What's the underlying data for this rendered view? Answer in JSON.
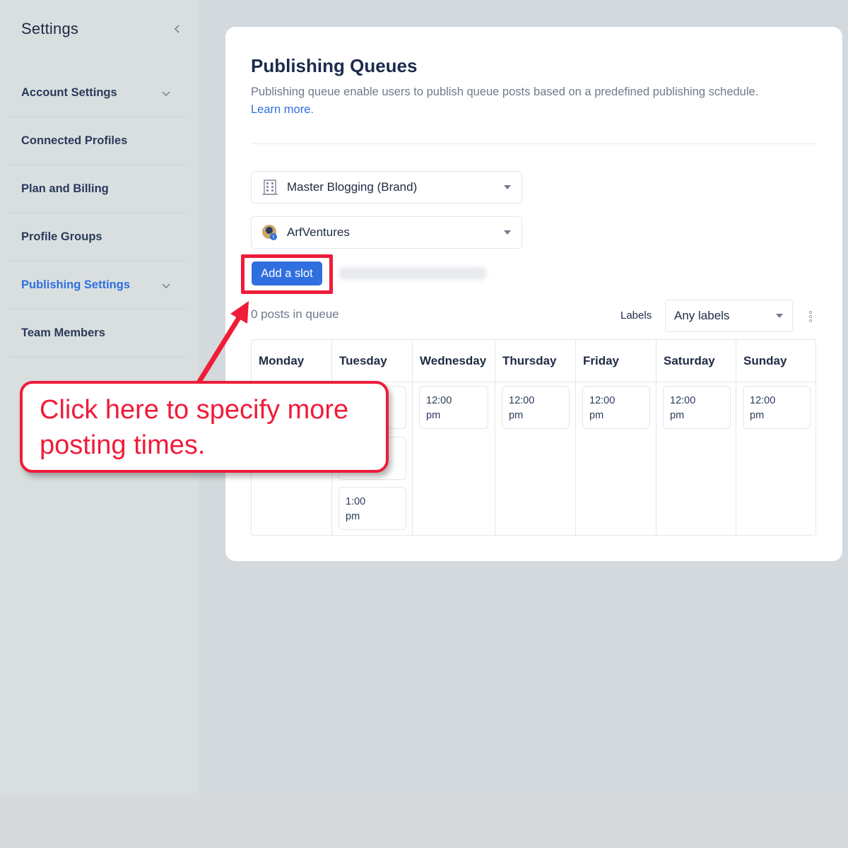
{
  "sidebar": {
    "title": "Settings",
    "items": [
      {
        "label": "Account Settings",
        "has_chevron": true,
        "active": false
      },
      {
        "label": "Connected Profiles",
        "has_chevron": false,
        "active": false
      },
      {
        "label": "Plan and Billing",
        "has_chevron": false,
        "active": false
      },
      {
        "label": "Profile Groups",
        "has_chevron": false,
        "active": false
      },
      {
        "label": "Publishing Settings",
        "has_chevron": true,
        "active": true
      },
      {
        "label": "Team Members",
        "has_chevron": false,
        "active": false
      }
    ]
  },
  "main": {
    "title": "Publishing Queues",
    "description": "Publishing queue enable users to publish queue posts based on a predefined publishing schedule.",
    "learn_more": "Learn more.",
    "brand_select": {
      "value": "Master Blogging (Brand)",
      "icon": "building-icon"
    },
    "profile_select": {
      "value": "ArfVentures",
      "icon": "profile-avatar"
    },
    "add_slot_label": "Add a slot",
    "queue_count": "0 posts in queue",
    "labels_label": "Labels",
    "labels_select": "Any labels",
    "days": [
      "Monday",
      "Tuesday",
      "Wednesday",
      "Thursday",
      "Friday",
      "Saturday",
      "Sunday"
    ],
    "slots": {
      "tuesday_3": [
        "1:00",
        "pm"
      ],
      "wednesday_1": [
        "12:00",
        "pm"
      ],
      "thursday_1": [
        "12:00",
        "pm"
      ],
      "friday_1": [
        "12:00",
        "pm"
      ],
      "saturday_1": [
        "12:00",
        "pm"
      ],
      "sunday_1": [
        "12:00",
        "pm"
      ]
    }
  },
  "callout": {
    "line1": "Click here to specify more",
    "line2": "posting times."
  },
  "colors": {
    "accent": "#2f6fe0",
    "annotation": "#ef1c3a",
    "title": "#1c2b4d"
  }
}
